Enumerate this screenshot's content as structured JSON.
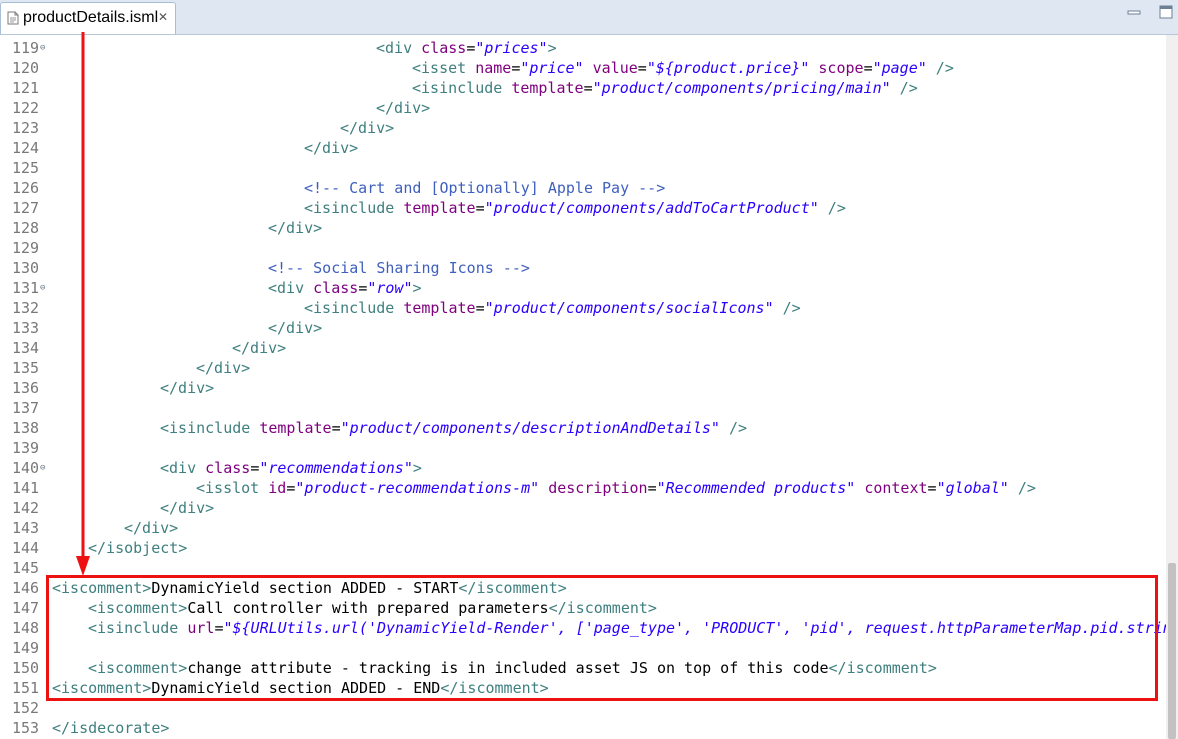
{
  "tab": {
    "title": "productDetails.isml",
    "icon": "file-icon",
    "close": "close-icon"
  },
  "annotation": {
    "color": "#ee1111",
    "shapes": [
      "arrow-down",
      "highlight-rectangle"
    ]
  },
  "lines": [
    {
      "n": "119",
      "fold": true,
      "indent": 36,
      "tokens": [
        [
          "tg",
          "<div "
        ],
        [
          "at",
          "class"
        ],
        [
          "tx",
          "="
        ],
        [
          "val",
          "\"prices\""
        ],
        [
          "tg",
          ">"
        ]
      ]
    },
    {
      "n": "120",
      "indent": 40,
      "tokens": [
        [
          "tg",
          "<isset "
        ],
        [
          "at",
          "name"
        ],
        [
          "tx",
          "="
        ],
        [
          "val",
          "\"price\""
        ],
        [
          "tx",
          " "
        ],
        [
          "at",
          "value"
        ],
        [
          "tx",
          "="
        ],
        [
          "val",
          "\"${product.price}\""
        ],
        [
          "tx",
          " "
        ],
        [
          "at",
          "scope"
        ],
        [
          "tx",
          "="
        ],
        [
          "val",
          "\"page\""
        ],
        [
          "tg",
          " />"
        ]
      ]
    },
    {
      "n": "121",
      "indent": 40,
      "tokens": [
        [
          "tg",
          "<isinclude "
        ],
        [
          "at",
          "template"
        ],
        [
          "tx",
          "="
        ],
        [
          "val",
          "\"product/components/pricing/main\""
        ],
        [
          "tg",
          " />"
        ]
      ]
    },
    {
      "n": "122",
      "indent": 36,
      "tokens": [
        [
          "tg",
          "</div>"
        ]
      ]
    },
    {
      "n": "123",
      "indent": 32,
      "tokens": [
        [
          "tg",
          "</div>"
        ]
      ]
    },
    {
      "n": "124",
      "indent": 28,
      "tokens": [
        [
          "tg",
          "</div>"
        ]
      ]
    },
    {
      "n": "125",
      "indent": 0,
      "tokens": []
    },
    {
      "n": "126",
      "indent": 28,
      "tokens": [
        [
          "cm",
          "<!-- Cart and [Optionally] Apple Pay -->"
        ]
      ]
    },
    {
      "n": "127",
      "indent": 28,
      "tokens": [
        [
          "tg",
          "<isinclude "
        ],
        [
          "at",
          "template"
        ],
        [
          "tx",
          "="
        ],
        [
          "val",
          "\"product/components/addToCartProduct\""
        ],
        [
          "tg",
          " />"
        ]
      ]
    },
    {
      "n": "128",
      "indent": 24,
      "tokens": [
        [
          "tg",
          "</div>"
        ]
      ]
    },
    {
      "n": "129",
      "indent": 0,
      "tokens": []
    },
    {
      "n": "130",
      "indent": 24,
      "tokens": [
        [
          "cm",
          "<!-- Social Sharing Icons -->"
        ]
      ]
    },
    {
      "n": "131",
      "fold": true,
      "indent": 24,
      "tokens": [
        [
          "tg",
          "<div "
        ],
        [
          "at",
          "class"
        ],
        [
          "tx",
          "="
        ],
        [
          "val",
          "\"row\""
        ],
        [
          "tg",
          ">"
        ]
      ]
    },
    {
      "n": "132",
      "indent": 28,
      "tokens": [
        [
          "tg",
          "<isinclude "
        ],
        [
          "at",
          "template"
        ],
        [
          "tx",
          "="
        ],
        [
          "val",
          "\"product/components/socialIcons\""
        ],
        [
          "tg",
          " />"
        ]
      ]
    },
    {
      "n": "133",
      "indent": 24,
      "tokens": [
        [
          "tg",
          "</div>"
        ]
      ]
    },
    {
      "n": "134",
      "indent": 20,
      "tokens": [
        [
          "tg",
          "</div>"
        ]
      ]
    },
    {
      "n": "135",
      "indent": 16,
      "tokens": [
        [
          "tg",
          "</div>"
        ]
      ]
    },
    {
      "n": "136",
      "indent": 12,
      "tokens": [
        [
          "tg",
          "</div>"
        ]
      ]
    },
    {
      "n": "137",
      "indent": 0,
      "tokens": []
    },
    {
      "n": "138",
      "indent": 12,
      "tokens": [
        [
          "tg",
          "<isinclude "
        ],
        [
          "at",
          "template"
        ],
        [
          "tx",
          "="
        ],
        [
          "val",
          "\"product/components/descriptionAndDetails\""
        ],
        [
          "tg",
          " />"
        ]
      ]
    },
    {
      "n": "139",
      "indent": 0,
      "tokens": []
    },
    {
      "n": "140",
      "fold": true,
      "indent": 12,
      "tokens": [
        [
          "tg",
          "<div "
        ],
        [
          "at",
          "class"
        ],
        [
          "tx",
          "="
        ],
        [
          "val",
          "\"recommendations\""
        ],
        [
          "tg",
          ">"
        ]
      ]
    },
    {
      "n": "141",
      "indent": 16,
      "tokens": [
        [
          "tg",
          "<isslot "
        ],
        [
          "at",
          "id"
        ],
        [
          "tx",
          "="
        ],
        [
          "val",
          "\"product-recommendations-m\""
        ],
        [
          "tx",
          " "
        ],
        [
          "at",
          "description"
        ],
        [
          "tx",
          "="
        ],
        [
          "val",
          "\"Recommended products\""
        ],
        [
          "tx",
          " "
        ],
        [
          "at",
          "context"
        ],
        [
          "tx",
          "="
        ],
        [
          "val",
          "\"global\""
        ],
        [
          "tg",
          " />"
        ]
      ]
    },
    {
      "n": "142",
      "indent": 12,
      "tokens": [
        [
          "tg",
          "</div>"
        ]
      ]
    },
    {
      "n": "143",
      "indent": 8,
      "tokens": [
        [
          "tg",
          "</div>"
        ]
      ]
    },
    {
      "n": "144",
      "indent": 4,
      "tokens": [
        [
          "tg",
          "</isobject>"
        ]
      ]
    },
    {
      "n": "145",
      "indent": 0,
      "tokens": []
    },
    {
      "n": "146",
      "indent": 0,
      "tokens": [
        [
          "tg",
          "<iscomment>"
        ],
        [
          "tx",
          "DynamicYield section ADDED - START"
        ],
        [
          "tg",
          "</iscomment>"
        ]
      ]
    },
    {
      "n": "147",
      "indent": 4,
      "tokens": [
        [
          "tg",
          "<iscomment>"
        ],
        [
          "tx",
          "Call controller with prepared parameters"
        ],
        [
          "tg",
          "</iscomment>"
        ]
      ]
    },
    {
      "n": "148",
      "indent": 4,
      "tokens": [
        [
          "tg",
          "<isinclude "
        ],
        [
          "at",
          "url"
        ],
        [
          "tx",
          "="
        ],
        [
          "val",
          "\"${URLUtils.url('DynamicYield-Render', ['page_type', 'PRODUCT', 'pid', request.httpParameterMap.pid.string"
        ]
      ]
    },
    {
      "n": "149",
      "indent": 0,
      "tokens": []
    },
    {
      "n": "150",
      "indent": 4,
      "tokens": [
        [
          "tg",
          "<iscomment>"
        ],
        [
          "tx",
          "change attribute - tracking is in included asset JS on top of this code"
        ],
        [
          "tg",
          "</iscomment>"
        ]
      ]
    },
    {
      "n": "151",
      "indent": 0,
      "tokens": [
        [
          "tg",
          "<iscomment>"
        ],
        [
          "tx",
          "DynamicYield section ADDED - END"
        ],
        [
          "tg",
          "</iscomment>"
        ]
      ]
    },
    {
      "n": "152",
      "indent": 0,
      "tokens": []
    },
    {
      "n": "153",
      "indent": 0,
      "tokens": [
        [
          "tg",
          "</isdecorate>"
        ]
      ]
    }
  ]
}
